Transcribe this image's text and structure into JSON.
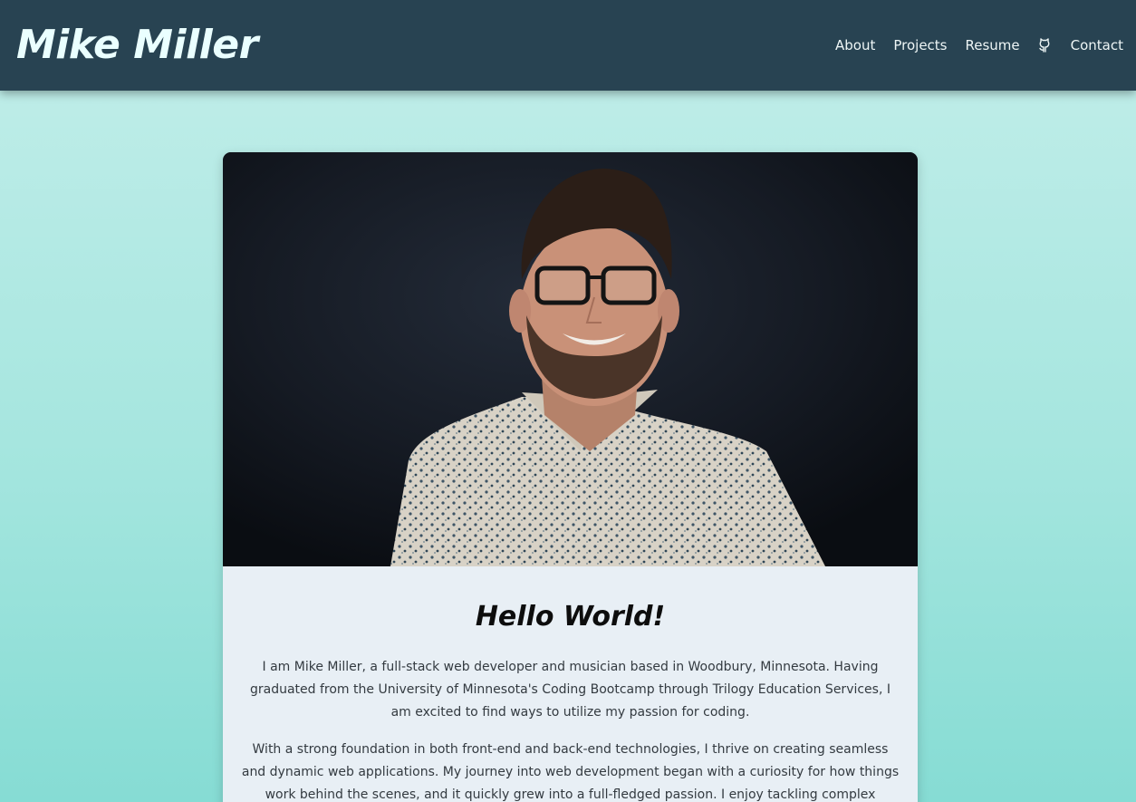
{
  "header": {
    "brand": "Mike Miller",
    "nav": {
      "about": "About",
      "projects": "Projects",
      "resume": "Resume",
      "github_icon": "github-icon",
      "contact": "Contact"
    }
  },
  "card": {
    "photo_alt": "Mike Miller",
    "title": "Hello World!",
    "paragraphs": [
      "I am Mike Miller, a full-stack web developer and musician based in Woodbury, Minnesota. Having graduated from the University of Minnesota's Coding Bootcamp through Trilogy Education Services, I am excited to find ways to utilize my passion for coding.",
      "With a strong foundation in both front-end and back-end technologies, I thrive on creating seamless and dynamic web applications. My journey into web development began with a curiosity for how things work behind the scenes, and it quickly grew into a full-fledged passion. I enjoy tackling complex problems and"
    ]
  },
  "colors": {
    "navbar": "#284352",
    "brand": "#eaffff",
    "card": "#e8eff5",
    "page_top": "#c3eeea",
    "page_bottom": "#86dcd4"
  }
}
